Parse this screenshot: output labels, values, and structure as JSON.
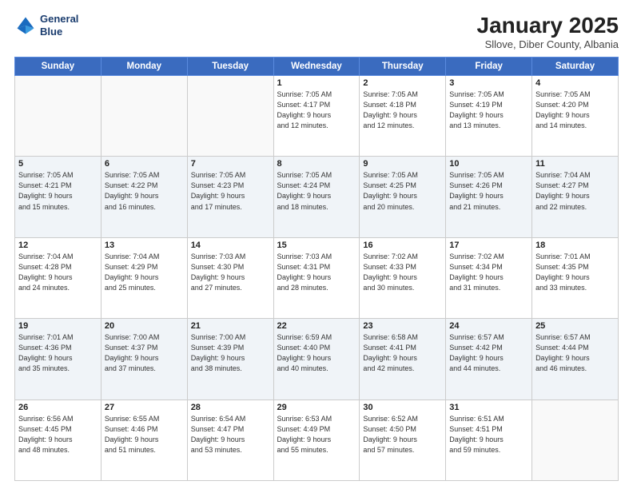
{
  "header": {
    "logo_line1": "General",
    "logo_line2": "Blue",
    "title": "January 2025",
    "subtitle": "Sllove, Diber County, Albania"
  },
  "days_of_week": [
    "Sunday",
    "Monday",
    "Tuesday",
    "Wednesday",
    "Thursday",
    "Friday",
    "Saturday"
  ],
  "weeks": [
    {
      "days": [
        {
          "num": "",
          "info": ""
        },
        {
          "num": "",
          "info": ""
        },
        {
          "num": "",
          "info": ""
        },
        {
          "num": "1",
          "info": "Sunrise: 7:05 AM\nSunset: 4:17 PM\nDaylight: 9 hours\nand 12 minutes."
        },
        {
          "num": "2",
          "info": "Sunrise: 7:05 AM\nSunset: 4:18 PM\nDaylight: 9 hours\nand 12 minutes."
        },
        {
          "num": "3",
          "info": "Sunrise: 7:05 AM\nSunset: 4:19 PM\nDaylight: 9 hours\nand 13 minutes."
        },
        {
          "num": "4",
          "info": "Sunrise: 7:05 AM\nSunset: 4:20 PM\nDaylight: 9 hours\nand 14 minutes."
        }
      ]
    },
    {
      "days": [
        {
          "num": "5",
          "info": "Sunrise: 7:05 AM\nSunset: 4:21 PM\nDaylight: 9 hours\nand 15 minutes."
        },
        {
          "num": "6",
          "info": "Sunrise: 7:05 AM\nSunset: 4:22 PM\nDaylight: 9 hours\nand 16 minutes."
        },
        {
          "num": "7",
          "info": "Sunrise: 7:05 AM\nSunset: 4:23 PM\nDaylight: 9 hours\nand 17 minutes."
        },
        {
          "num": "8",
          "info": "Sunrise: 7:05 AM\nSunset: 4:24 PM\nDaylight: 9 hours\nand 18 minutes."
        },
        {
          "num": "9",
          "info": "Sunrise: 7:05 AM\nSunset: 4:25 PM\nDaylight: 9 hours\nand 20 minutes."
        },
        {
          "num": "10",
          "info": "Sunrise: 7:05 AM\nSunset: 4:26 PM\nDaylight: 9 hours\nand 21 minutes."
        },
        {
          "num": "11",
          "info": "Sunrise: 7:04 AM\nSunset: 4:27 PM\nDaylight: 9 hours\nand 22 minutes."
        }
      ]
    },
    {
      "days": [
        {
          "num": "12",
          "info": "Sunrise: 7:04 AM\nSunset: 4:28 PM\nDaylight: 9 hours\nand 24 minutes."
        },
        {
          "num": "13",
          "info": "Sunrise: 7:04 AM\nSunset: 4:29 PM\nDaylight: 9 hours\nand 25 minutes."
        },
        {
          "num": "14",
          "info": "Sunrise: 7:03 AM\nSunset: 4:30 PM\nDaylight: 9 hours\nand 27 minutes."
        },
        {
          "num": "15",
          "info": "Sunrise: 7:03 AM\nSunset: 4:31 PM\nDaylight: 9 hours\nand 28 minutes."
        },
        {
          "num": "16",
          "info": "Sunrise: 7:02 AM\nSunset: 4:33 PM\nDaylight: 9 hours\nand 30 minutes."
        },
        {
          "num": "17",
          "info": "Sunrise: 7:02 AM\nSunset: 4:34 PM\nDaylight: 9 hours\nand 31 minutes."
        },
        {
          "num": "18",
          "info": "Sunrise: 7:01 AM\nSunset: 4:35 PM\nDaylight: 9 hours\nand 33 minutes."
        }
      ]
    },
    {
      "days": [
        {
          "num": "19",
          "info": "Sunrise: 7:01 AM\nSunset: 4:36 PM\nDaylight: 9 hours\nand 35 minutes."
        },
        {
          "num": "20",
          "info": "Sunrise: 7:00 AM\nSunset: 4:37 PM\nDaylight: 9 hours\nand 37 minutes."
        },
        {
          "num": "21",
          "info": "Sunrise: 7:00 AM\nSunset: 4:39 PM\nDaylight: 9 hours\nand 38 minutes."
        },
        {
          "num": "22",
          "info": "Sunrise: 6:59 AM\nSunset: 4:40 PM\nDaylight: 9 hours\nand 40 minutes."
        },
        {
          "num": "23",
          "info": "Sunrise: 6:58 AM\nSunset: 4:41 PM\nDaylight: 9 hours\nand 42 minutes."
        },
        {
          "num": "24",
          "info": "Sunrise: 6:57 AM\nSunset: 4:42 PM\nDaylight: 9 hours\nand 44 minutes."
        },
        {
          "num": "25",
          "info": "Sunrise: 6:57 AM\nSunset: 4:44 PM\nDaylight: 9 hours\nand 46 minutes."
        }
      ]
    },
    {
      "days": [
        {
          "num": "26",
          "info": "Sunrise: 6:56 AM\nSunset: 4:45 PM\nDaylight: 9 hours\nand 48 minutes."
        },
        {
          "num": "27",
          "info": "Sunrise: 6:55 AM\nSunset: 4:46 PM\nDaylight: 9 hours\nand 51 minutes."
        },
        {
          "num": "28",
          "info": "Sunrise: 6:54 AM\nSunset: 4:47 PM\nDaylight: 9 hours\nand 53 minutes."
        },
        {
          "num": "29",
          "info": "Sunrise: 6:53 AM\nSunset: 4:49 PM\nDaylight: 9 hours\nand 55 minutes."
        },
        {
          "num": "30",
          "info": "Sunrise: 6:52 AM\nSunset: 4:50 PM\nDaylight: 9 hours\nand 57 minutes."
        },
        {
          "num": "31",
          "info": "Sunrise: 6:51 AM\nSunset: 4:51 PM\nDaylight: 9 hours\nand 59 minutes."
        },
        {
          "num": "",
          "info": ""
        }
      ]
    }
  ]
}
